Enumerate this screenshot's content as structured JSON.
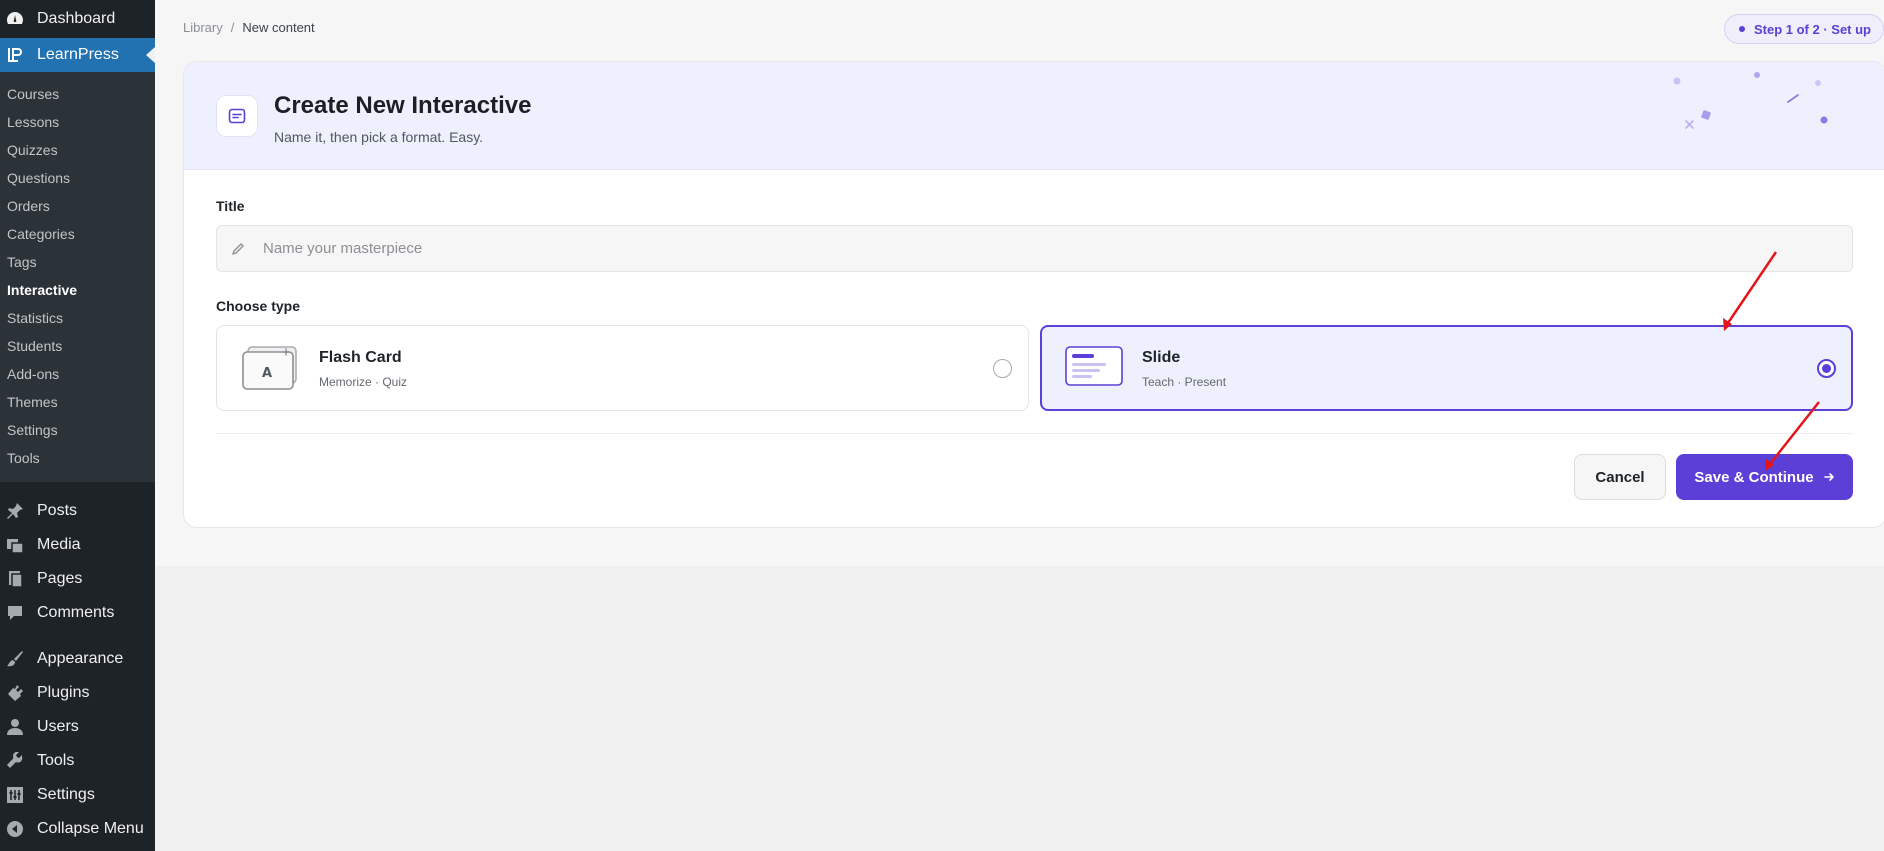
{
  "sidebar": {
    "dashboard": "Dashboard",
    "learnpress": "LearnPress",
    "submenu": [
      "Courses",
      "Lessons",
      "Quizzes",
      "Questions",
      "Orders",
      "Categories",
      "Tags",
      "Interactive",
      "Statistics",
      "Students",
      "Add-ons",
      "Themes",
      "Settings",
      "Tools"
    ],
    "current_sub": "Interactive",
    "menu": [
      "Posts",
      "Media",
      "Pages",
      "Comments",
      "Appearance",
      "Plugins",
      "Users",
      "Tools",
      "Settings",
      "Collapse Menu"
    ]
  },
  "breadcrumb": {
    "root": "Library",
    "sep": "/",
    "current": "New content"
  },
  "step": "Step 1 of 2 · Set up",
  "header": {
    "title": "Create New Interactive",
    "subtitle": "Name it, then pick a format. Easy."
  },
  "form": {
    "title_label": "Title",
    "title_placeholder": "Name your masterpiece",
    "title_value": "",
    "type_label": "Choose type",
    "types": [
      {
        "name": "Flash Card",
        "desc": "Memorize · Quiz",
        "selected": false
      },
      {
        "name": "Slide",
        "desc": "Teach · Present",
        "selected": true
      }
    ]
  },
  "actions": {
    "cancel": "Cancel",
    "save": "Save & Continue"
  },
  "colors": {
    "accent": "#5b3fd6",
    "sidebar": "#1d2327",
    "active": "#2271b1",
    "annotation": "#e5141b"
  }
}
